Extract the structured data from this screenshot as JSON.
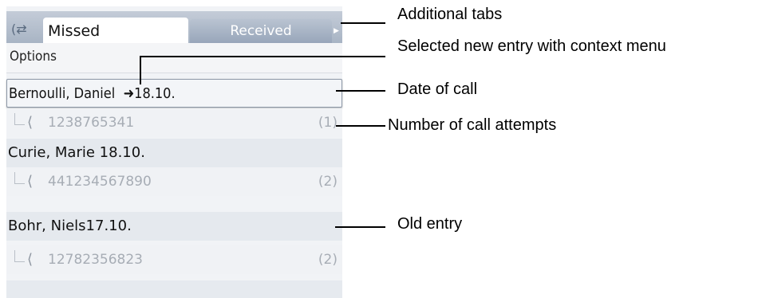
{
  "tabs": {
    "icon": "call-list-icon",
    "missed_label": "Missed",
    "received_label": "Received"
  },
  "options_label": "Options",
  "entries": [
    {
      "name": "Bernoulli, Daniel",
      "date": "18.10.",
      "number": "1238765341",
      "attempts": "(1)",
      "selected": true
    },
    {
      "name": "Curie, Marie",
      "date": "18.10.",
      "number": "441234567890",
      "attempts": "(2)",
      "selected": false
    },
    {
      "name": "Bohr, Niels",
      "date": "17.10.",
      "number": "12782356823",
      "attempts": "(2)",
      "selected": false
    }
  ],
  "annotations": {
    "additional_tabs": "Additional tabs",
    "selected_entry": "Selected new entry with context menu",
    "date_of_call": "Date of call",
    "call_attempts": "Number of call attempts",
    "old_entry": "Old entry"
  }
}
